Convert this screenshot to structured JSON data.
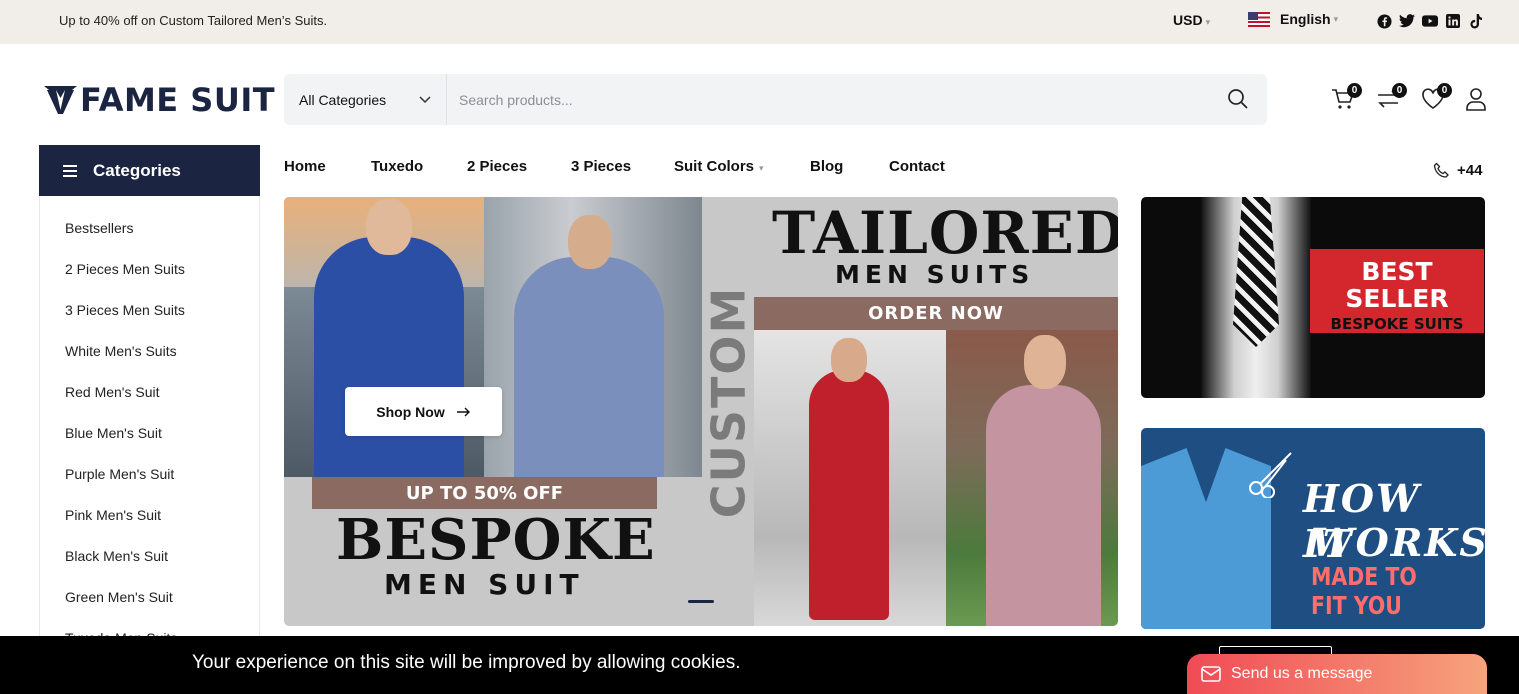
{
  "topbar": {
    "promo": "Up to 40% off on Custom Tailored Men’s Suits.",
    "currency": "USD",
    "language": "English",
    "social_icons": [
      "facebook-icon",
      "twitter-icon",
      "youtube-icon",
      "linkedin-icon",
      "tiktok-icon"
    ]
  },
  "header": {
    "logo_text": "FAME SUIT",
    "category_select": "All Categories",
    "search_placeholder": "Search products...",
    "cart_count": "0",
    "compare_count": "0",
    "wishlist_count": "0"
  },
  "categories": {
    "title": "Categories",
    "items": [
      "Bestsellers",
      "2 Pieces Men Suits",
      "3 Pieces Men Suits",
      "White Men's Suits",
      "Red Men's Suit",
      "Blue Men's Suit",
      "Purple Men's Suit",
      "Pink Men's Suit",
      "Black Men's Suit",
      "Green Men's Suit",
      "Tuxedo Men Suits"
    ]
  },
  "nav": {
    "items": [
      "Home",
      "Tuxedo",
      "2 Pieces",
      "3 Pieces",
      "Suit Colors",
      "Blog",
      "Contact"
    ],
    "phone": "+44"
  },
  "hero": {
    "shop_now": "Shop Now",
    "offer": "UP TO 50% OFF",
    "headline_1": "BESPOKE",
    "headline_2": "MEN SUIT",
    "vertical": "CUSTOM",
    "headline_3": "TAILORED",
    "headline_4": "MEN SUITS",
    "cta": "ORDER NOW"
  },
  "side_banners": {
    "best_1": "BEST",
    "best_2": "SELLER",
    "best_3": "BESPOKE SUITS",
    "how_1": "HOW IT",
    "how_2": "WORKS",
    "how_3": "MADE TO FIT YOU"
  },
  "cookie": {
    "text": "Your experience on this site will be improved by allowing cookies."
  },
  "chat": {
    "label": "Send us a message"
  },
  "colors": {
    "brand_navy": "#1b2440",
    "accent_brown": "#8b6a61",
    "best_red": "#d4262d",
    "how_blue": "#1f4f82"
  }
}
